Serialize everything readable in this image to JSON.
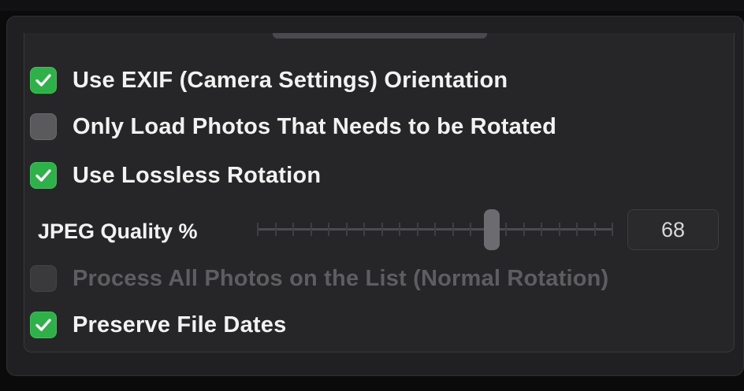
{
  "options": [
    {
      "label": "Use EXIF (Camera Settings) Orientation",
      "checked": true,
      "enabled": true
    },
    {
      "label": "Only Load Photos That Needs to be Rotated",
      "checked": false,
      "enabled": true
    },
    {
      "label": "Use Lossless Rotation",
      "checked": true,
      "enabled": true
    },
    {
      "label": "Process All Photos on the List (Normal Rotation)",
      "checked": false,
      "enabled": false
    },
    {
      "label": "Preserve File Dates",
      "checked": true,
      "enabled": true
    }
  ],
  "jpeg_quality": {
    "label": "JPEG Quality %",
    "value": "68",
    "slider_fraction": 0.66
  },
  "colors": {
    "checkbox_checked": "#2fb14a",
    "checkbox_unchecked": "#5a5a5d",
    "text": "#f2f2f2",
    "text_disabled": "#5e5e62"
  },
  "icons": {
    "checkmark": "checkmark-icon"
  }
}
